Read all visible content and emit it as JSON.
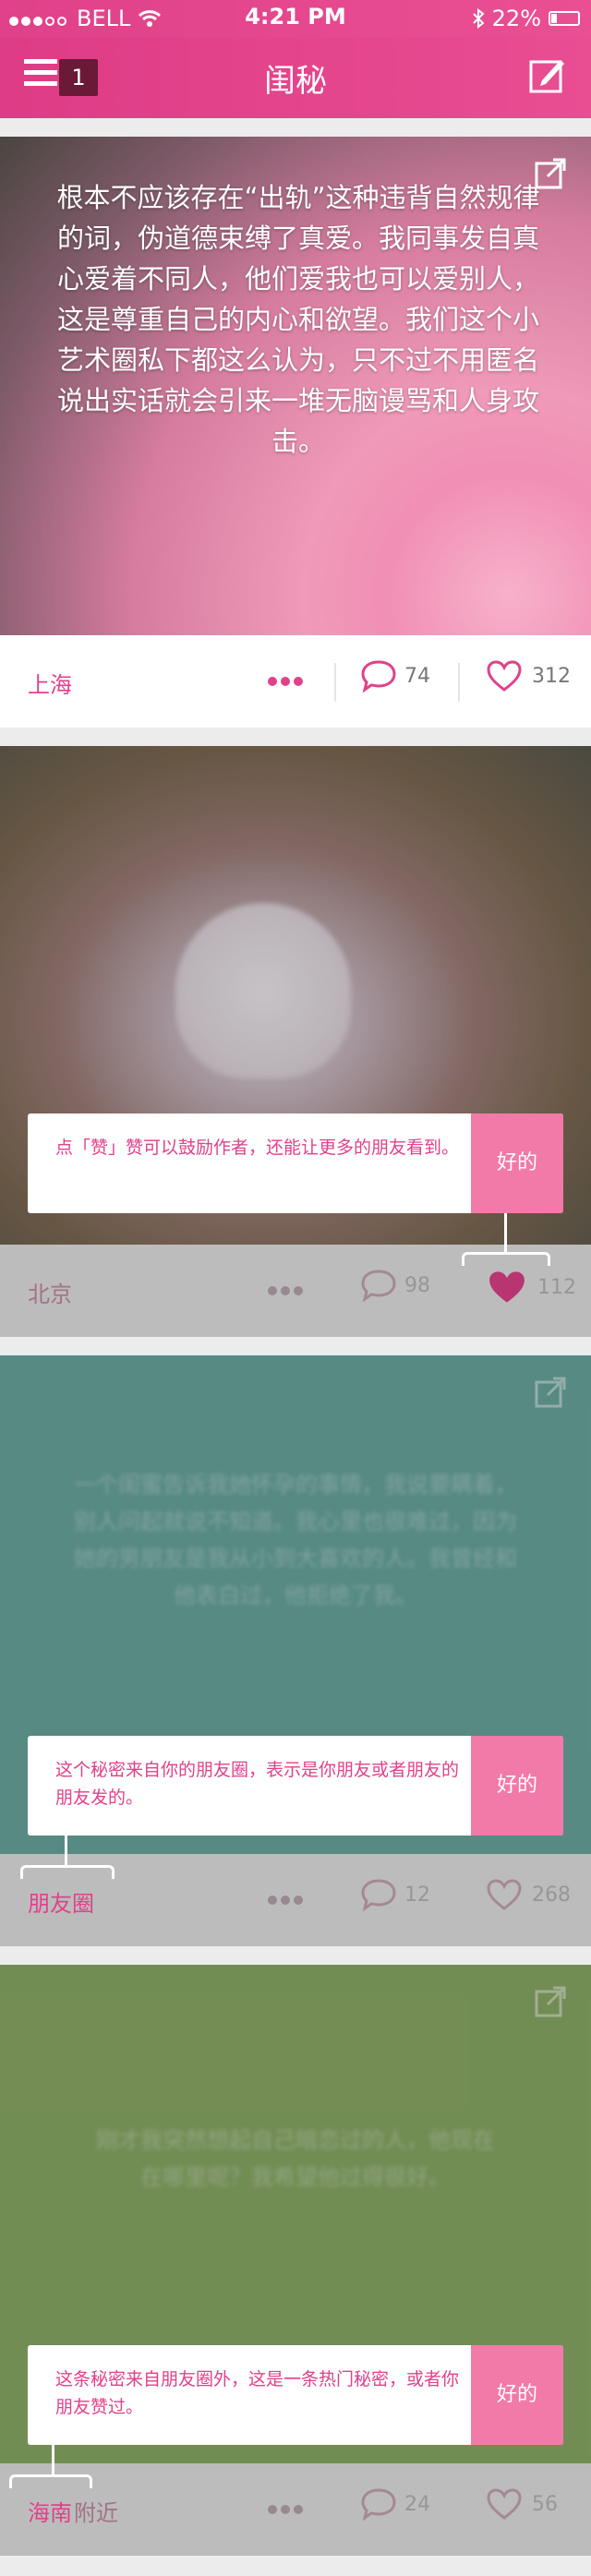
{
  "statusbar": {
    "carrier": "BELL",
    "time": "4:21 PM",
    "battery": "22%"
  },
  "navbar": {
    "title": "闺秘",
    "badge": "1"
  },
  "cards": [
    {
      "text": "根本不应该存在“出轨”这种违背自然规律的词，伪道德束缚了真爱。我同事发自真心爱着不同人，他们爱我也可以爱别人，这是尊重自己的内心和欲望。我们这个小艺术圈私下都这么认为，只不过不用匿名说出实话就会引来一堆无脑谩骂和人身攻击。",
      "location": "上海",
      "comments": "74",
      "likes": "312"
    },
    {
      "text": "",
      "location": "北京",
      "comments": "98",
      "likes": "112",
      "tip": "点「赞」赞可以鼓励作者，还能让更多的朋友看到。",
      "tip_ok": "好的"
    },
    {
      "text": "一个闺蜜告诉我她怀孕的事情，我说要瞒着，别人问起就说不知道。我心里也很难过，因为她的男朋友是我从小到大喜欢的人。我曾经和他表白过，他拒绝了我。",
      "location": "朋友圈",
      "comments": "12",
      "likes": "268",
      "tip": "这个秘密来自你的朋友圈，表示是你朋友或者朋友的朋友发的。",
      "tip_ok": "好的"
    },
    {
      "text": "刚才我突然想起自己暗恋过的人，他现在在哪里呢？我希望他过得很好。",
      "location": "海南",
      "location_suffix": "附近",
      "comments": "24",
      "likes": "56",
      "tip": "这条秘密来自朋友圈外，这是一条热门秘密，或者你朋友赞过。",
      "tip_ok": "好的"
    }
  ],
  "colors": {
    "accent": "#e0418a",
    "tip_button": "#f27aa8"
  }
}
